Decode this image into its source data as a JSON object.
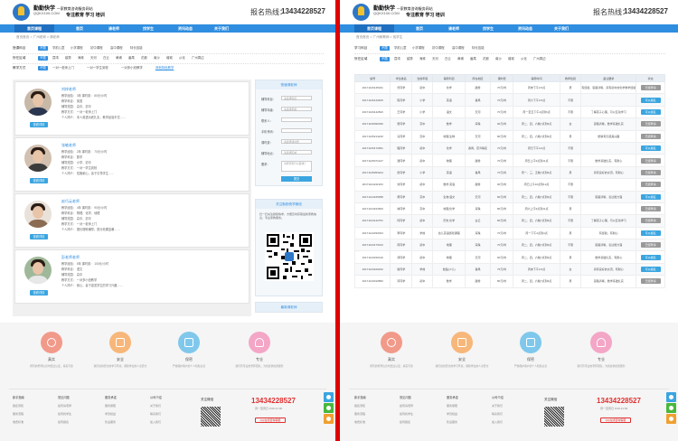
{
  "brand": {
    "name": "勤勤快学",
    "tagline": "一家教育咨询服务网站",
    "domain": "QQKX100.COM",
    "slogan": "专注教育 学习 培训"
  },
  "hotline": {
    "label": "报名热线：",
    "number": "13434228527"
  },
  "nav": [
    "首页课程",
    "首页",
    "请老师",
    "找学生",
    "资讯动态",
    "关于我们"
  ],
  "left": {
    "breadcrumb": "首页首页  >  广州老师  >  请老师",
    "filters": [
      {
        "label": "授课科目",
        "options": [
          "不限",
          "学前儿童",
          "小学课程",
          "初中课程",
          "高中课程",
          "特长技能"
        ]
      },
      {
        "label": "所在区域",
        "options": [
          "不限",
          "荔湾",
          "越秀",
          "海珠",
          "天河",
          "白云",
          "黄埔",
          "番禺",
          "花都",
          "南沙",
          "增城",
          "从化",
          "广州周边"
        ]
      },
      {
        "label": "教学方式",
        "options": [
          "不限",
          "一对一老师上门",
          "一对一学生到校",
          "一对多小班教学",
          "其他特色教学"
        ]
      }
    ],
    "teachers": [
      {
        "name": "刘梓老师",
        "l1": "教学经验：  3年   课时费：  80元/小时",
        "l2": "教学科目：  英语",
        "l3": "辅导范围：  高中、初中",
        "l4": "教学方式：  一对一老师上门",
        "l5": "个人简介：  本人英语功底扎实，教学经验丰富……",
        "btn": "查看详情"
      },
      {
        "name": "张敏老师",
        "l1": "教学经验：  2年   课时费：  70元/小时",
        "l2": "教学科目：  数学",
        "l3": "辅导范围：  小学、初中",
        "l4": "教学方式：  一对一学生到校",
        "l5": "个人简介：  性格耐心，善于引导学生……",
        "btn": "查看详情"
      },
      {
        "name": "赵巧云老师",
        "l1": "教学经验：  4年   课时费：  90元/小时",
        "l2": "教学科目：  物理、化学、地理",
        "l3": "辅导范围：  高中、初中",
        "l4": "教学方式：  一对一老师上门",
        "l5": "个人简介：  擅长理科辅导，提分效果显著……",
        "btn": "查看详情"
      },
      {
        "name": "彭老师老师",
        "l1": "教学经验：  5年   课时费：  100元/小时",
        "l2": "教学科目：  语文",
        "l3": "辅导范围：  高中",
        "l4": "教学方式：  一对多小班教学",
        "l5": "个人简介：  耐心，善于激发学生的学习兴趣……",
        "btn": "查看详情"
      }
    ],
    "sidebar": {
      "form_title": "快速请老师",
      "fields": [
        {
          "label": "辅导科目：",
          "ph": "请选择科目"
        },
        {
          "label": "辅导年级：",
          "ph": "请选择年级"
        },
        {
          "label": "联系人：",
          "ph": ""
        },
        {
          "label": "手机号码：",
          "ph": ""
        },
        {
          "label": "课时费：",
          "ph": "请选择课时费"
        },
        {
          "label": "辅导地点：",
          "ph": "请选择区域"
        },
        {
          "label": "要求：",
          "ph": "对老师有什么要求？"
        }
      ],
      "submit": "提交",
      "wechat_title": "关注勤勤快学微信",
      "wechat_text": "扫一扫关注勤勤快学，方便及时获取最新家教信息，专业家教服务。",
      "more_title": "最新请老师"
    }
  },
  "right": {
    "breadcrumb": "首页首页  >  广州家教网  >  找学生",
    "filters": [
      {
        "label": "学习科目",
        "options": [
          "不限",
          "学前儿童",
          "小学课程",
          "初中课程",
          "高中课程",
          "特长技能"
        ]
      },
      {
        "label": "所在区域",
        "options": [
          "不限",
          "荔湾",
          "越秀",
          "海珠",
          "天河",
          "白云",
          "黄埔",
          "番禺",
          "花都",
          "南沙",
          "增城",
          "从化",
          "广州周边"
        ]
      }
    ],
    "table": {
      "headers": [
        "编号",
        "学生姓名",
        "当前年级",
        "辅导科目",
        "所在地区",
        "课时费",
        "辅导时间",
        "教师性别",
        "备注要求",
        "状态"
      ],
      "rows": [
        [
          "20171126145041",
          "曾同学",
          "初中",
          "化学",
          "越秀",
          "70元/时",
          "周末下午3-5点",
          "男",
          "有经验、思路清晰、具有初中的化学教学经验",
          "已经聘请"
        ],
        [
          "20171126143405",
          "陈同学",
          "小学",
          "英语",
          "番禺",
          "70元/时",
          "周六下午3-5点",
          "不限",
          "",
          "可以报名"
        ],
        [
          "20171126142820",
          "王同学",
          "小学",
          "语文",
          "天河",
          "70元/时",
          "周一至五下午4点到6点",
          "不限",
          "了解孩子心理，可以互动学习",
          "可以报名"
        ],
        [
          "20171126090036",
          "吴同学",
          "高中",
          "数学",
          "海珠",
          "90元/时",
          "周二、四，六晚7点到9点",
          "女",
          "思路清晰，数学基础扎实",
          "已经聘请"
        ],
        [
          "20171125214240",
          "马同学",
          "高中",
          "地理,生物",
          "天河",
          "80元/时",
          "周二、四，六晚7点到9点",
          "男",
          "能够有引起其兴趣",
          "已经聘请"
        ],
        [
          "20171125172951",
          "程同学",
          "初中",
          "化学",
          "番禺，荔湾等区",
          "70元/时",
          "周日下午4-6点",
          "不限",
          "",
          "可以报名"
        ],
        [
          "20171125071447",
          "潘同学",
          "初中",
          "物理",
          "越秀",
          "70元/时",
          "周日上午9点到11点",
          "不限",
          "数学基础扎实，有耐心",
          "已经聘请"
        ],
        [
          "20171125053224",
          "张同学",
          "小学",
          "英语",
          "番禺",
          "70元/时",
          "周一、三，五晚7点到9点",
          "男",
          "具有良好的交流，有耐心",
          "已经聘请"
        ],
        [
          "20171124211303",
          "刘同学",
          "初中",
          "数学,英语",
          "越秀",
          "90元/时",
          "周日上午10点到12点",
          "不限",
          "",
          "已经聘请"
        ],
        [
          "20171124165058",
          "黄同学",
          "高中",
          "生物,语文",
          "天河",
          "80元/时",
          "周二、四，六晚7点到9点",
          "不限",
          "思路清晰，表达能力强",
          "可以报名"
        ],
        [
          "20171124154609",
          "林同学",
          "高中",
          "地理,化学",
          "海珠",
          "80元/时",
          "周六上午9点到11点",
          "男",
          "",
          "已经聘请"
        ],
        [
          "20171124142751",
          "何同学",
          "初中",
          "历史,化学",
          "白云",
          "80元/时",
          "周二、四，六晚7点到9点",
          "不限",
          "了解孩子心理，可以互动学习",
          "已经聘请"
        ],
        [
          "20171124033034",
          "李同学",
          "学前",
          "幼儿英语游戏课程",
          "海珠",
          "70元/时",
          "周一下午2点到4点",
          "男",
          "有经验，有耐心",
          "可以报名"
        ],
        [
          "20171123173013",
          "周同学",
          "初中",
          "地理",
          "海珠",
          "70元/时",
          "周二、四，六晚7点到9点",
          "不限",
          "思路清晰，表达能力强",
          "已经聘请"
        ],
        [
          "20171123150130",
          "郭同学",
          "初中",
          "物理",
          "天河",
          "90元/时",
          "周二、四，六晚7点到9点",
          "男",
          "数学基础扎实，有耐心",
          "可以报名"
        ],
        [
          "20171123100232",
          "谢同学",
          "学前",
          "舞蹈(少儿)",
          "番禺",
          "75元/时",
          "周末下午3-5点",
          "女",
          "具有良好的交流，有耐心",
          "可以报名"
        ],
        [
          "20171123010850",
          "邓同学",
          "初中",
          "数学",
          "越秀",
          "80元/时",
          "周二、四，六晚7点到9点",
          "男",
          "思路清晰，数学基础扎实",
          "已经聘请"
        ]
      ]
    }
  },
  "footer": {
    "features": [
      {
        "name": "真实",
        "desc": "所有的老师信息均经过认证，真实可靠"
      },
      {
        "name": "安全",
        "desc": "我们提供安全的学习环境，保障学生的人身安全"
      },
      {
        "name": "保密",
        "desc": "严格保护用户的个人隐私信息"
      },
      {
        "name": "专业",
        "desc": "我们有专业的老师团队，为您提供优质服务"
      }
    ],
    "columns": [
      {
        "title": "新手指南",
        "items": [
          "报名须知",
          "服务流程",
          "收费标准"
        ]
      },
      {
        "title": "常见问题",
        "items": [
          "如何请老师",
          "如何找学生",
          "如何报名"
        ]
      },
      {
        "title": "服务承诺",
        "items": [
          "服务保障",
          "学员权益",
          "售后服务"
        ]
      },
      {
        "title": "公司介绍",
        "items": [
          "关于我们",
          "联系我们",
          "加入我们"
        ]
      }
    ],
    "follow": "关注微信",
    "phone": "13434228527",
    "phone_sub": "周一至周日 9:00-21:00",
    "consult": "QQ在线咨询客服"
  }
}
